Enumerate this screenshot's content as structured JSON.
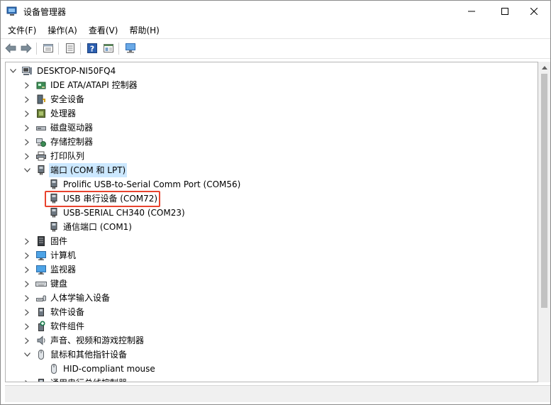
{
  "window": {
    "title": "设备管理器",
    "controls": {
      "minimize": "—",
      "maximize": "☐",
      "close": "✕"
    }
  },
  "menu": [
    {
      "label": "文件(F)"
    },
    {
      "label": "操作(A)"
    },
    {
      "label": "查看(V)"
    },
    {
      "label": "帮助(H)"
    }
  ],
  "toolbar": {
    "back_icon": "back-arrow-icon",
    "forward_icon": "forward-arrow-icon",
    "properties_icon": "properties-icon",
    "details_icon": "details-icon",
    "help_icon": "help-icon",
    "view_icon": "view-icon",
    "monitor_icon": "scan-hardware-icon"
  },
  "tree": {
    "root": "DESKTOP-NI50FQ4",
    "items": [
      {
        "label": "IDE ATA/ATAPI 控制器",
        "icon": "ide-controller-icon",
        "expanded": false
      },
      {
        "label": "安全设备",
        "icon": "security-device-icon",
        "expanded": false
      },
      {
        "label": "处理器",
        "icon": "processor-icon",
        "expanded": false
      },
      {
        "label": "磁盘驱动器",
        "icon": "disk-drive-icon",
        "expanded": false
      },
      {
        "label": "存储控制器",
        "icon": "storage-controller-icon",
        "expanded": false
      },
      {
        "label": "打印队列",
        "icon": "printer-icon",
        "expanded": false
      },
      {
        "label": "端口 (COM 和 LPT)",
        "icon": "port-icon",
        "expanded": true,
        "children": [
          {
            "label": "Prolific USB-to-Serial Comm Port (COM56)",
            "icon": "port-icon"
          },
          {
            "label": "USB 串行设备 (COM72)",
            "icon": "port-icon"
          },
          {
            "label": "USB-SERIAL CH340 (COM23)",
            "icon": "port-icon"
          },
          {
            "label": "通信端口 (COM1)",
            "icon": "port-icon"
          }
        ]
      },
      {
        "label": "固件",
        "icon": "firmware-icon",
        "expanded": false
      },
      {
        "label": "计算机",
        "icon": "computer-icon",
        "expanded": false
      },
      {
        "label": "监视器",
        "icon": "monitor-icon",
        "expanded": false
      },
      {
        "label": "键盘",
        "icon": "keyboard-icon",
        "expanded": false
      },
      {
        "label": "人体学输入设备",
        "icon": "hid-icon",
        "expanded": false
      },
      {
        "label": "软件设备",
        "icon": "software-device-icon",
        "expanded": false
      },
      {
        "label": "软件组件",
        "icon": "software-component-icon",
        "expanded": false
      },
      {
        "label": "声音、视频和游戏控制器",
        "icon": "audio-icon",
        "expanded": false
      },
      {
        "label": "鼠标和其他指针设备",
        "icon": "mouse-icon",
        "expanded": true,
        "children": [
          {
            "label": "HID-compliant mouse",
            "icon": "mouse-icon"
          }
        ]
      },
      {
        "label": "通用串行总线控制器",
        "icon": "usb-controller-icon",
        "expanded": false
      }
    ]
  },
  "colors": {
    "selection": "#cce8ff",
    "highlight_border": "#e8432e"
  }
}
